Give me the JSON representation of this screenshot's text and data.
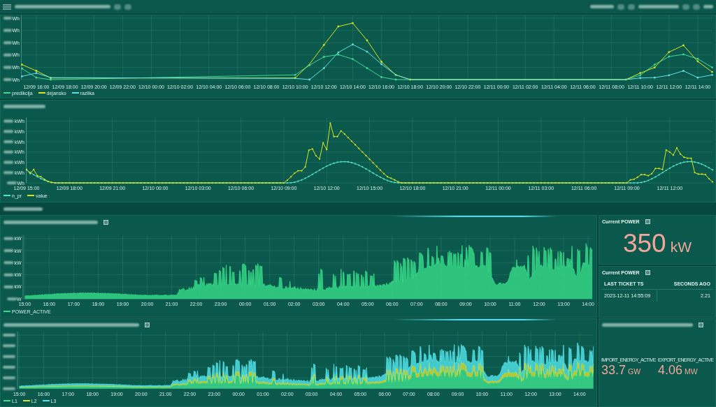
{
  "energy_chart": {
    "kind": "line",
    "y_axis_labels": [
      "Wh",
      "Wh",
      "Wh",
      "Wh",
      "Wh",
      "Wh"
    ],
    "x_axis_labels": [
      "12/09 16:00",
      "12/09 18:00",
      "12/09 20:00",
      "12/09 22:00",
      "12/10 00:00",
      "12/10 02:00",
      "12/10 04:00",
      "12/10 06:00",
      "12/10 08:00",
      "12/10 10:00",
      "12/10 12:00",
      "12/10 14:00",
      "12/10 16:00",
      "12/10 18:00",
      "12/10 20:00",
      "12/10 22:00",
      "12/11 00:00",
      "12/11 02:00",
      "12/11 04:00",
      "12/11 06:00",
      "12/11 08:00",
      "12/11 10:00",
      "12/11 12:00",
      "12/11 14:00"
    ],
    "legend": [
      {
        "label": "predikcija",
        "color": "#3fd897"
      },
      {
        "label": "dejansko",
        "color": "#d4e61e"
      },
      {
        "label": "razlika",
        "color": "#62dfe6"
      }
    ]
  },
  "prediction_chart": {
    "kind": "line",
    "y_axis_labels": [
      "kWh",
      "kWh",
      "kWh",
      "kWh",
      "kWh",
      "kWh",
      "Wh"
    ],
    "x_axis_labels": [
      "12/09 15:00",
      "12/09 18:00",
      "12/09 21:00",
      "12/10 00:00",
      "12/10 03:00",
      "12/10 06:00",
      "12/10 09:00",
      "12/10 12:00",
      "12/10 15:00",
      "12/10 18:00",
      "12/10 21:00",
      "12/11 00:00",
      "12/11 03:00",
      "12/11 06:00",
      "12/11 09:00",
      "12/11 12:00"
    ],
    "legend": [
      {
        "label": "n_pr",
        "color": "#52e3c8"
      },
      {
        "label": "value",
        "color": "#d6e41e"
      }
    ]
  },
  "power_chart": {
    "kind": "area",
    "y_axis_labels": [
      "kW",
      "kW",
      "kW",
      "kW",
      "kW",
      "W"
    ],
    "x_axis_labels": [
      "15:00",
      "16:00",
      "17:00",
      "18:00",
      "19:00",
      "20:00",
      "21:00",
      "22:00",
      "23:00",
      "00:00",
      "01:00",
      "02:00",
      "03:00",
      "04:00",
      "05:00",
      "06:00",
      "07:00",
      "08:00",
      "09:00",
      "10:00",
      "11:00",
      "12:00",
      "13:00",
      "14:00"
    ],
    "legend": [
      {
        "label": "POWER_ACTIVE",
        "color": "#36dd88"
      }
    ]
  },
  "current_power": {
    "title": "Current POWER",
    "value": "350",
    "unit": "kW"
  },
  "last_ticket": {
    "title": "Current POWER",
    "columns": [
      "LAST TICKET TS",
      "SECONDS AGO"
    ],
    "rows": [
      [
        "2023-12-11 14:55:09",
        "2.21"
      ]
    ]
  },
  "phase_chart": {
    "kind": "stacked_area",
    "x_axis_labels": [
      "15:00",
      "16:00",
      "17:00",
      "18:00",
      "19:00",
      "20:00",
      "21:00",
      "22:00",
      "23:00",
      "00:00",
      "01:00",
      "02:00",
      "03:00",
      "04:00",
      "05:00",
      "06:00",
      "07:00",
      "08:00",
      "09:00",
      "10:00",
      "11:00",
      "12:00",
      "13:00",
      "14:00"
    ],
    "legend": [
      {
        "label": "L1",
        "color": "#3ee292"
      },
      {
        "label": "L2",
        "color": "#dfe330"
      },
      {
        "label": "L3",
        "color": "#52e6ec"
      }
    ]
  },
  "energy_totals": {
    "stats": [
      {
        "label": "IMPORT_ENERGY_ACTIVE",
        "value": "33.7",
        "unit": "GW"
      },
      {
        "label": "EXPORT_ENERGY_ACTIVE",
        "value": "4.06",
        "unit": "MW"
      }
    ]
  }
}
